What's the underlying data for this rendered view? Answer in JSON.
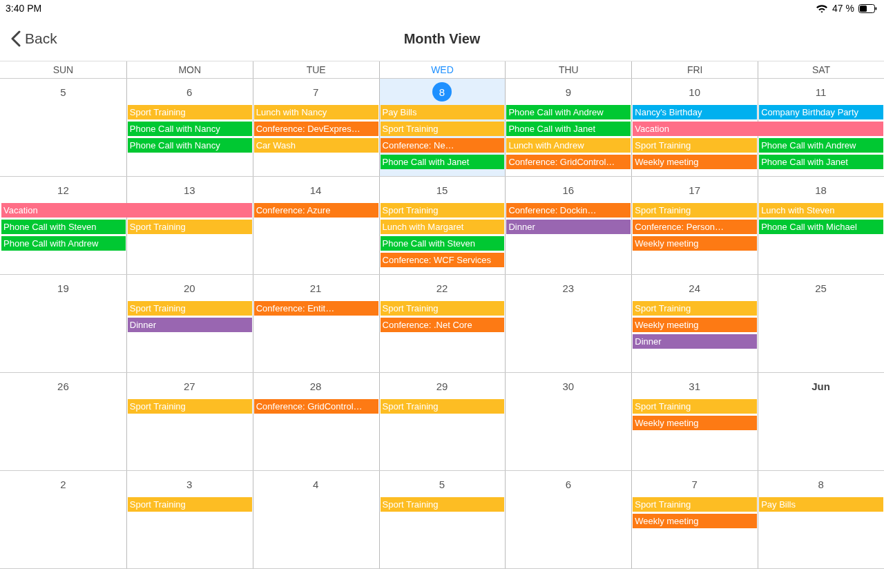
{
  "status_bar": {
    "time": "3:40 PM",
    "battery": "47 %"
  },
  "nav": {
    "back": "Back",
    "title": "Month View"
  },
  "weekdays": [
    {
      "label": "SUN",
      "today": false
    },
    {
      "label": "MON",
      "today": false
    },
    {
      "label": "TUE",
      "today": false
    },
    {
      "label": "WED",
      "today": true
    },
    {
      "label": "THU",
      "today": false
    },
    {
      "label": "FRI",
      "today": false
    },
    {
      "label": "SAT",
      "today": false
    }
  ],
  "weeks": [
    {
      "days": [
        {
          "label": "5",
          "today": false,
          "month_start": false
        },
        {
          "label": "6",
          "today": false,
          "month_start": false,
          "events": [
            {
              "title": "Sport Training",
              "color": "#fdbd23"
            },
            {
              "title": "Phone Call with Nancy",
              "color": "#00c832"
            },
            {
              "title": "Phone Call with Nancy",
              "color": "#00c832"
            }
          ]
        },
        {
          "label": "7",
          "today": false,
          "month_start": false,
          "events": [
            {
              "title": "Lunch with Nancy",
              "color": "#fdbd23"
            },
            {
              "title": "Conference: DevExpres…",
              "color": "#fd7a14"
            },
            {
              "title": "Car Wash",
              "color": "#fdbd23"
            }
          ]
        },
        {
          "label": "8",
          "today": true,
          "month_start": false,
          "events": [
            {
              "title": "Pay Bills",
              "color": "#fdbd23"
            },
            {
              "title": "Sport Training",
              "color": "#fdbd23"
            },
            {
              "title": "Conference: Ne…",
              "color": "#fd7a14"
            },
            {
              "title": "Phone Call with Janet",
              "color": "#00c832"
            }
          ]
        },
        {
          "label": "9",
          "today": false,
          "month_start": false,
          "events": [
            {
              "title": "Phone Call with Andrew",
              "color": "#00c832"
            },
            {
              "title": "Phone Call with Janet",
              "color": "#00c832"
            },
            {
              "title": "Lunch with Andrew",
              "color": "#fdbd23"
            },
            {
              "title": "Conference: GridControl…",
              "color": "#fd7a14"
            }
          ]
        },
        {
          "label": "10",
          "today": false,
          "month_start": false,
          "events": [
            {
              "title": "Nancy's Birthday",
              "color": "#00b0ef"
            },
            {
              "title": "Vacation",
              "color": "#ff6e87",
              "continues": true
            },
            {
              "title": "Sport Training",
              "color": "#fdbd23"
            },
            {
              "title": "Weekly meeting",
              "color": "#fd7a14"
            }
          ]
        },
        {
          "label": "11",
          "today": false,
          "month_start": false,
          "events": [
            {
              "title": "Company Birthday Party",
              "color": "#00b0ef"
            },
            {
              "title": "Phone Call with Andrew",
              "color": "#00c832"
            },
            {
              "title": "Phone Call with Janet",
              "color": "#00c832"
            }
          ]
        }
      ]
    },
    {
      "days": [
        {
          "label": "12",
          "today": false,
          "month_start": false,
          "events": [
            {
              "title": "Vacation",
              "color": "#ff6e87",
              "continues": true
            },
            {
              "title": "Phone Call with Steven",
              "color": "#00c832"
            },
            {
              "title": "Phone Call with Andrew",
              "color": "#00c832"
            }
          ]
        },
        {
          "label": "13",
          "today": false,
          "month_start": false,
          "events": [
            {
              "title": "Sport Training",
              "color": "#fdbd23"
            }
          ]
        },
        {
          "label": "14",
          "today": false,
          "month_start": false,
          "events": [
            {
              "title": "Conference: Azure",
              "color": "#fd7a14"
            }
          ]
        },
        {
          "label": "15",
          "today": false,
          "month_start": false,
          "events": [
            {
              "title": "Sport Training",
              "color": "#fdbd23"
            },
            {
              "title": "Lunch with Margaret",
              "color": "#fdbd23"
            },
            {
              "title": "Phone Call with Steven",
              "color": "#00c832"
            },
            {
              "title": "Conference: WCF Services",
              "color": "#fd7a14"
            }
          ]
        },
        {
          "label": "16",
          "today": false,
          "month_start": false,
          "events": [
            {
              "title": "Conference: Dockin…",
              "color": "#fd7a14"
            },
            {
              "title": "Dinner",
              "color": "#9966b1"
            }
          ]
        },
        {
          "label": "17",
          "today": false,
          "month_start": false,
          "events": [
            {
              "title": "Sport Training",
              "color": "#fdbd23"
            },
            {
              "title": "Conference: Person…",
              "color": "#fd7a14"
            },
            {
              "title": "Weekly meeting",
              "color": "#fd7a14"
            }
          ]
        },
        {
          "label": "18",
          "today": false,
          "month_start": false,
          "events": [
            {
              "title": "Lunch with Steven",
              "color": "#fdbd23"
            },
            {
              "title": "Phone Call with Michael",
              "color": "#00c832"
            }
          ]
        }
      ]
    },
    {
      "days": [
        {
          "label": "19",
          "today": false,
          "month_start": false
        },
        {
          "label": "20",
          "today": false,
          "month_start": false,
          "events": [
            {
              "title": "Sport Training",
              "color": "#fdbd23"
            },
            {
              "title": "Dinner",
              "color": "#9966b1"
            }
          ]
        },
        {
          "label": "21",
          "today": false,
          "month_start": false,
          "events": [
            {
              "title": "Conference: Entit…",
              "color": "#fd7a14"
            }
          ]
        },
        {
          "label": "22",
          "today": false,
          "month_start": false,
          "events": [
            {
              "title": "Sport Training",
              "color": "#fdbd23"
            },
            {
              "title": "Conference: .Net Core",
              "color": "#fd7a14"
            }
          ]
        },
        {
          "label": "23",
          "today": false,
          "month_start": false
        },
        {
          "label": "24",
          "today": false,
          "month_start": false,
          "events": [
            {
              "title": "Sport Training",
              "color": "#fdbd23"
            },
            {
              "title": "Weekly meeting",
              "color": "#fd7a14"
            },
            {
              "title": "Dinner",
              "color": "#9966b1"
            }
          ]
        },
        {
          "label": "25",
          "today": false,
          "month_start": false
        }
      ]
    },
    {
      "days": [
        {
          "label": "26",
          "today": false,
          "month_start": false
        },
        {
          "label": "27",
          "today": false,
          "month_start": false,
          "events": [
            {
              "title": "Sport Training",
              "color": "#fdbd23"
            }
          ]
        },
        {
          "label": "28",
          "today": false,
          "month_start": false,
          "events": [
            {
              "title": "Conference: GridControl…",
              "color": "#fd7a14"
            }
          ]
        },
        {
          "label": "29",
          "today": false,
          "month_start": false,
          "events": [
            {
              "title": "Sport Training",
              "color": "#fdbd23"
            }
          ]
        },
        {
          "label": "30",
          "today": false,
          "month_start": false
        },
        {
          "label": "31",
          "today": false,
          "month_start": false,
          "events": [
            {
              "title": "Sport Training",
              "color": "#fdbd23"
            },
            {
              "title": "Weekly meeting",
              "color": "#fd7a14"
            }
          ]
        },
        {
          "label": "Jun",
          "today": false,
          "month_start": true
        }
      ]
    },
    {
      "days": [
        {
          "label": "2",
          "today": false,
          "month_start": false
        },
        {
          "label": "3",
          "today": false,
          "month_start": false,
          "events": [
            {
              "title": "Sport Training",
              "color": "#fdbd23"
            }
          ]
        },
        {
          "label": "4",
          "today": false,
          "month_start": false
        },
        {
          "label": "5",
          "today": false,
          "month_start": false,
          "events": [
            {
              "title": "Sport Training",
              "color": "#fdbd23"
            }
          ]
        },
        {
          "label": "6",
          "today": false,
          "month_start": false
        },
        {
          "label": "7",
          "today": false,
          "month_start": false,
          "events": [
            {
              "title": "Sport Training",
              "color": "#fdbd23"
            },
            {
              "title": "Weekly meeting",
              "color": "#fd7a14"
            }
          ]
        },
        {
          "label": "8",
          "today": false,
          "month_start": false,
          "events": [
            {
              "title": "Pay Bills",
              "color": "#fdbd23"
            }
          ]
        }
      ]
    }
  ]
}
